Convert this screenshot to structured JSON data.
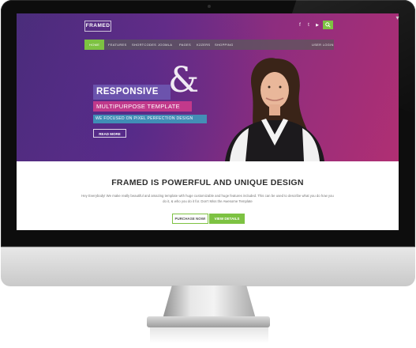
{
  "site": {
    "logo": "FRAMED",
    "social": [
      {
        "icon": "facebook-icon",
        "glyph": "f"
      },
      {
        "icon": "twitter-icon",
        "glyph": "t"
      },
      {
        "icon": "youtube-icon",
        "glyph": "▶"
      }
    ],
    "search_icon": "search-icon",
    "nav": [
      {
        "label": "HOME",
        "active": true
      },
      {
        "label": "FEATURES"
      },
      {
        "label": "SHORTCODES"
      },
      {
        "label": "JOOMLA"
      },
      {
        "label": "PAGES"
      },
      {
        "label": "K2ZERS"
      },
      {
        "label": "SHOPPING"
      }
    ],
    "nav_right": "USER LOGIN"
  },
  "hero": {
    "headline": "RESPONSIVE",
    "ampersand": "&",
    "subheadline": "MULTIPURPOSE TEMPLATE",
    "tagline": "WE FOCUSED ON PIXEL PERFECTION DESIGN",
    "cta": "READ MORE"
  },
  "intro": {
    "title": "FRAMED IS POWERFUL AND UNIQUE DESIGN",
    "body": "Hey Everybody! We make really beautiful and amazing template with huge customizable and huge features included. This can be used to describe what you do how you do it, & who you do it for. Don't Miss the Awesome Template",
    "purchase_label": "PURCHASE NOW!",
    "details_label": "VIEW DETAILS"
  },
  "colors": {
    "accent": "#7dc242",
    "hero_start": "#4a2d7a",
    "hero_end": "#b02f73",
    "headline_bg": "#6e5ab4",
    "sub_bg": "#d23c8c",
    "tag_bg": "#3ca0be"
  }
}
